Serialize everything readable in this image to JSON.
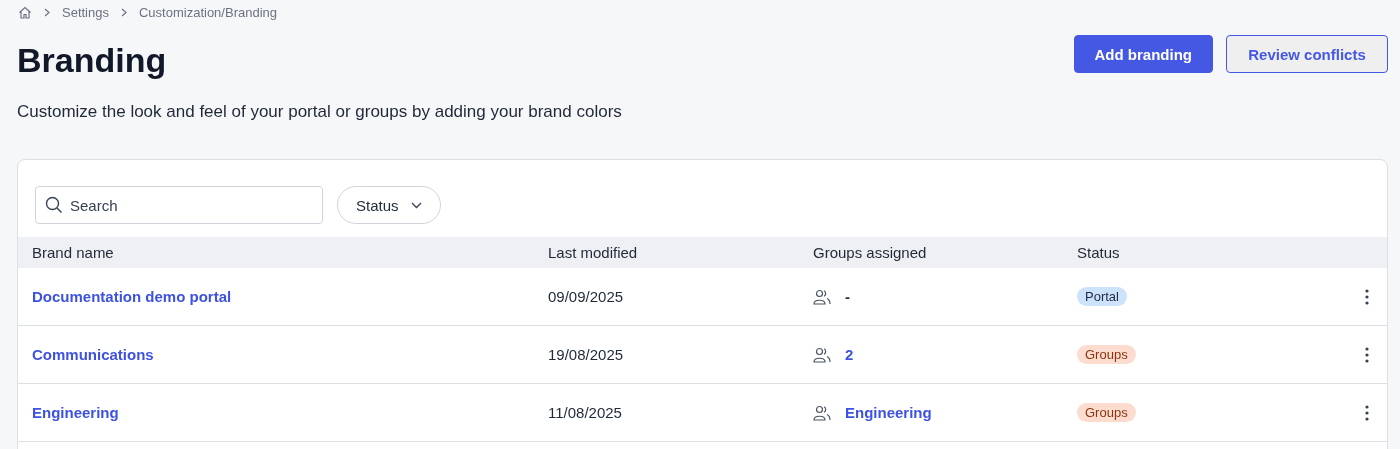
{
  "breadcrumb": [
    "Settings",
    "Customization/Branding"
  ],
  "title": "Branding",
  "buttons": [
    {
      "label": "Add branding",
      "kind": "primary"
    },
    {
      "label": "Review conflicts",
      "kind": "secondary"
    }
  ],
  "description": "Customize the look and feel of your portal or groups by adding your brand colors",
  "search": {
    "placeholder": "Search"
  },
  "filter": {
    "label": "Status"
  },
  "table": {
    "columns": [
      "Brand name",
      "Last modified",
      "Groups assigned",
      "Status"
    ],
    "rows": [
      {
        "name": "Documentation demo portal",
        "modified": "09/09/2025",
        "groups": {
          "text": "-",
          "kind": "plain"
        },
        "status": {
          "label": "Portal",
          "kind": "portal"
        }
      },
      {
        "name": "Communications",
        "modified": "19/08/2025",
        "groups": {
          "text": "2",
          "kind": "link"
        },
        "status": {
          "label": "Groups",
          "kind": "groups"
        }
      },
      {
        "name": "Engineering",
        "modified": "11/08/2025",
        "groups": {
          "text": "Engineering",
          "kind": "link"
        },
        "status": {
          "label": "Groups",
          "kind": "groups"
        }
      }
    ]
  }
}
